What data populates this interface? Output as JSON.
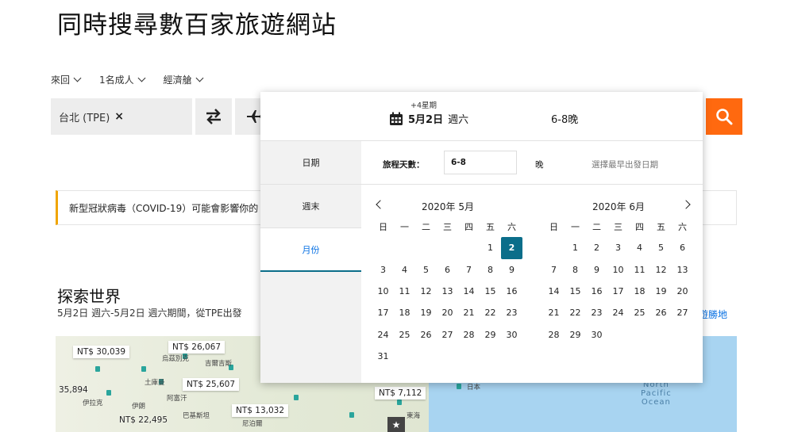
{
  "headline": "同時搜尋數百家旅遊網站",
  "options": {
    "trip_type": "來回",
    "travelers": "1名成人",
    "cabin": "經濟艙"
  },
  "search": {
    "origin": "台北 (TPE)",
    "origin_clear": "×"
  },
  "notice": "新型冠狀病毒（COVID-19）可能會影響你的",
  "explore": {
    "title": "探索世界",
    "subtitle": "5月2日 週六-5月2日 週六期間，從TPE出發",
    "link": "旅遊勝地"
  },
  "map": {
    "prices": [
      "NT$ 30,039",
      "NT$ 26,067",
      "NT$ 25,607",
      "35,894",
      "NT$ 22,495",
      "NT$ 13,032",
      "NT$ 7,112"
    ],
    "labels": [
      "烏茲別克",
      "吉爾吉斯",
      "伊朗",
      "阿富汗",
      "巴基斯坦",
      "土庫曼",
      "伊拉克",
      "尼泊爾",
      "日本",
      "東海"
    ],
    "ocean": "North\nPacific\nOcean"
  },
  "popup": {
    "weeks_hint": "+4星期",
    "date": "5月2日",
    "weekday": "週六",
    "nights": "6-8晚",
    "tabs": [
      "日期",
      "週末",
      "月份"
    ],
    "active_tab": "月份",
    "duration_label": "旅程天數：",
    "duration_value": "6-8",
    "duration_unit": "晚",
    "duration_note": "選擇最早出發日期",
    "weekdays": [
      "日",
      "一",
      "二",
      "三",
      "四",
      "五",
      "六"
    ],
    "months": [
      {
        "title": "2020年 5月",
        "lead_blanks": 5,
        "days": 31,
        "selected": 2
      },
      {
        "title": "2020年 6月",
        "lead_blanks": 1,
        "days": 30,
        "selected": null
      }
    ]
  },
  "colors": {
    "accent": "#ff690f",
    "selected": "#0b6e8a",
    "link": "#0770e3",
    "notice_bar": "#f0a500"
  }
}
